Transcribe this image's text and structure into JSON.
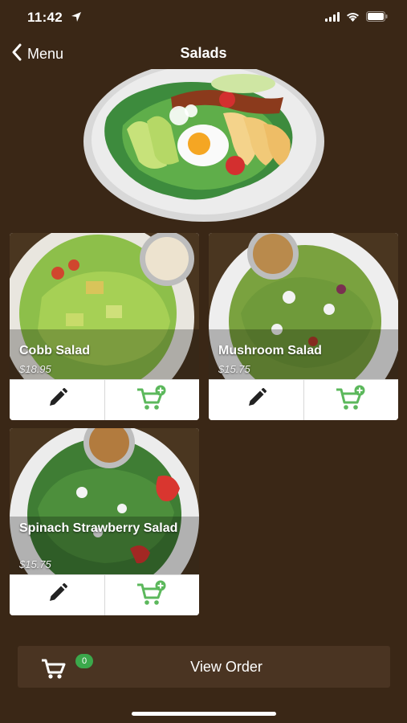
{
  "status": {
    "time": "11:42"
  },
  "nav": {
    "back_label": "Menu",
    "title": "Salads"
  },
  "items": [
    {
      "name": "Cobb Salad",
      "price": "$18.95"
    },
    {
      "name": "Mushroom Salad",
      "price": "$15.75"
    },
    {
      "name": "Spinach Strawberry Salad",
      "price": "$15.75"
    }
  ],
  "order": {
    "label": "View Order",
    "count": "0"
  },
  "colors": {
    "background": "#3a2716",
    "order_bar": "#4a3422",
    "accent_green": "#5cb85c",
    "badge_green": "#3ba84b"
  },
  "icons": [
    "chevron-left-icon",
    "pencil-icon",
    "add-to-cart-icon",
    "cart-icon",
    "wifi-icon",
    "battery-icon",
    "location-arrow-icon"
  ]
}
